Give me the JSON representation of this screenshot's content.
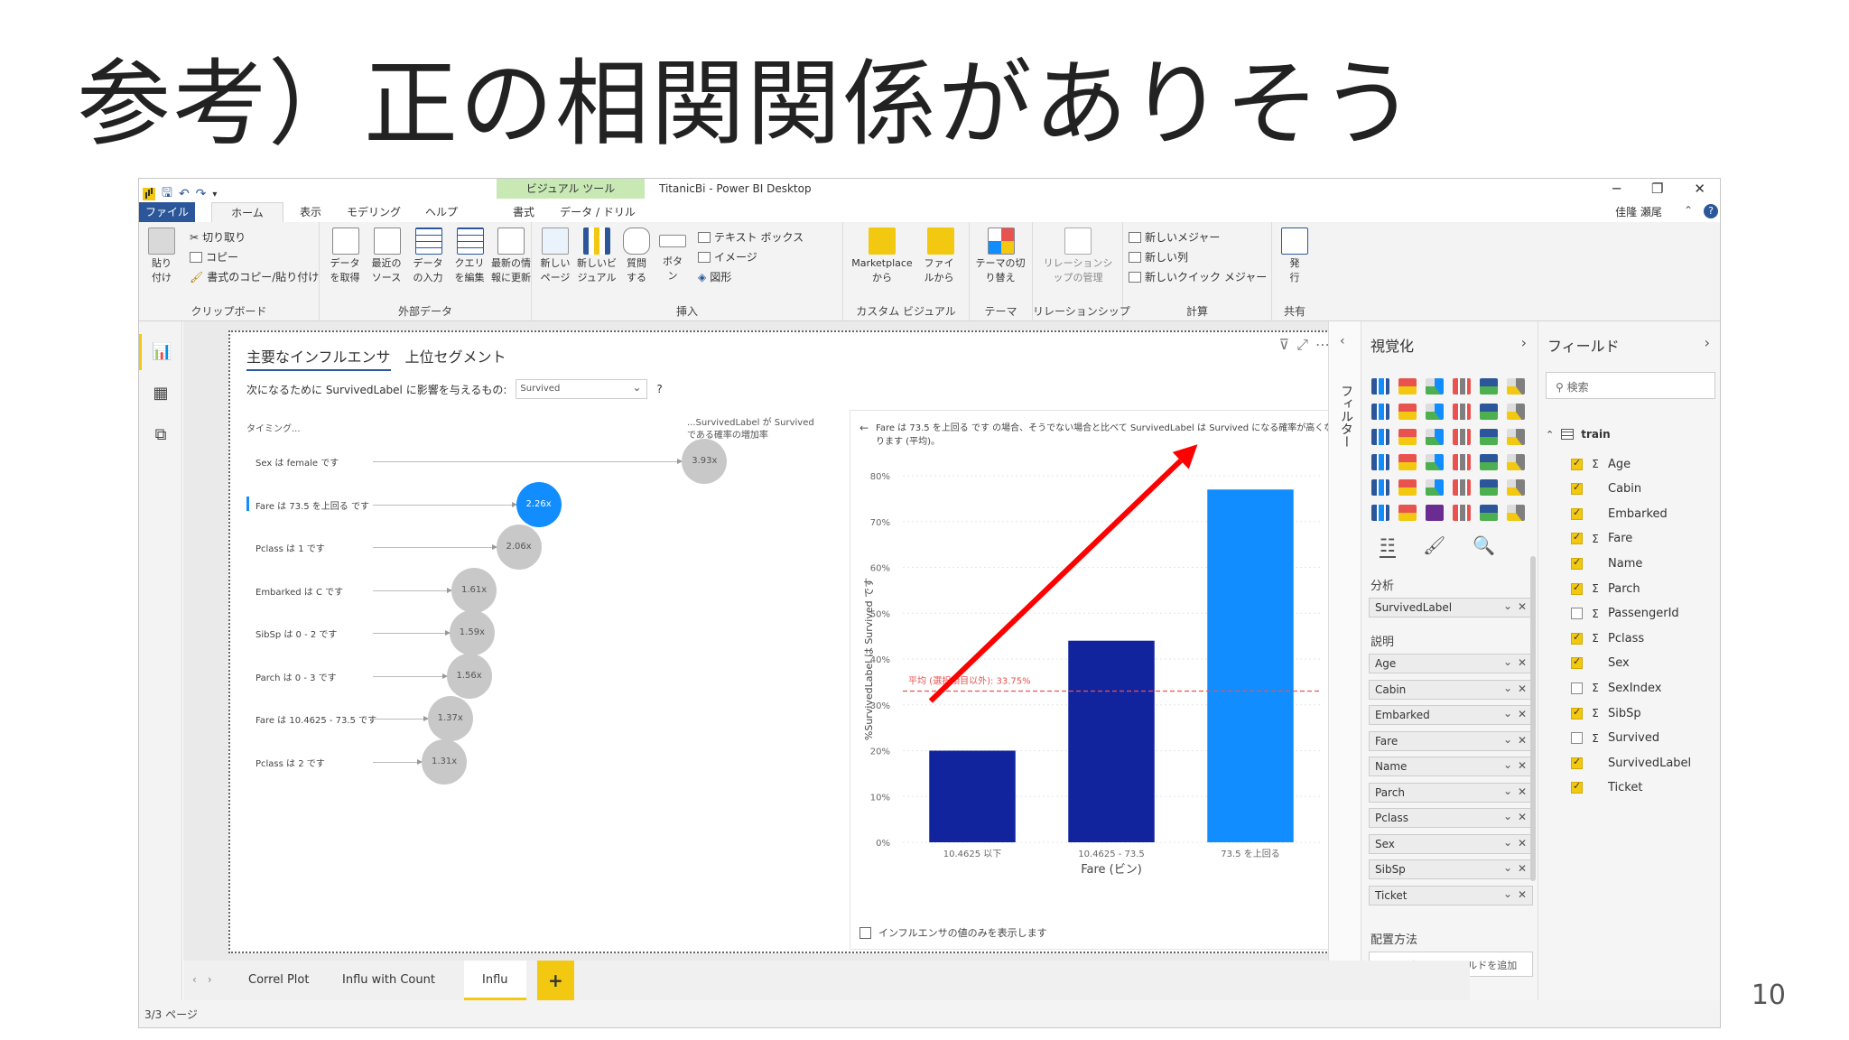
{
  "slide": {
    "title": "参考）正の相関関係がありそう",
    "number": "10"
  },
  "app": {
    "window_title": "TitanicBi - Power BI Desktop",
    "tool_tab": "ビジュアル ツール",
    "user": "佳隆 瀬尾",
    "tabs": [
      "ファイル",
      "ホーム",
      "表示",
      "モデリング",
      "ヘルプ",
      "書式",
      "データ / ドリル"
    ],
    "ribbon": {
      "clipboard": {
        "label": "クリップボード",
        "paste": "貼り付け",
        "cut": "切り取り",
        "copy": "コピー",
        "format_painter": "書式のコピー/貼り付け"
      },
      "external": {
        "label": "外部データ",
        "get_data": "データを取得",
        "recent": "最近のソース",
        "enter": "データの入力",
        "edit_query": "クエリを編集",
        "refresh": "最新の情報に更新"
      },
      "insert": {
        "label": "挿入",
        "new_page": "新しいページ",
        "new_visual": "新しいビジュアル",
        "ask": "質問する",
        "buttons": "ボタン",
        "textbox": "テキスト ボックス",
        "image": "イメージ",
        "shapes": "図形"
      },
      "custom": {
        "label": "カスタム ビジュアル",
        "marketplace": "Marketplace から",
        "file": "ファイルから"
      },
      "themes": {
        "label": "テーマ",
        "switch": "テーマの切り替え"
      },
      "relations": {
        "label": "リレーションシップ",
        "manage": "リレーションシップの管理"
      },
      "calc": {
        "label": "計算",
        "new_measure": "新しいメジャー",
        "new_column": "新しい列",
        "quick_measure": "新しいクイック メジャー"
      },
      "share": {
        "label": "共有",
        "publish": "発行"
      }
    }
  },
  "key_influencers": {
    "tab_main": "主要なインフルエンサ",
    "tab_segments": "上位セグメント",
    "question": "次になるために SurvivedLabel に影響を与えるもの:",
    "dropdown_value": "Survived",
    "help": "?",
    "col_left": "タイミング...",
    "col_right": "...SurvivedLabel が Survived である確率の増加率",
    "factors": [
      {
        "label": "Sex は female です",
        "value": 3.93,
        "text": "3.93x",
        "selected": false
      },
      {
        "label": "Fare は 73.5 を上回る です",
        "value": 2.26,
        "text": "2.26x",
        "selected": true
      },
      {
        "label": "Pclass は 1 です",
        "value": 2.06,
        "text": "2.06x",
        "selected": false
      },
      {
        "label": "Embarked は C です",
        "value": 1.61,
        "text": "1.61x",
        "selected": false
      },
      {
        "label": "SibSp は 0 - 2 です",
        "value": 1.59,
        "text": "1.59x",
        "selected": false
      },
      {
        "label": "Parch は 0 - 3 です",
        "value": 1.56,
        "text": "1.56x",
        "selected": false
      },
      {
        "label": "Fare は 10.4625 - 73.5 です",
        "value": 1.37,
        "text": "1.37x",
        "selected": false
      },
      {
        "label": "Pclass は 2 です",
        "value": 1.31,
        "text": "1.31x",
        "selected": false
      }
    ],
    "detail_description": "Fare は 73.5 を上回る です の場合、そうでない場合と比べて SurvivedLabel は Survived になる確率が高くなります (平均)。",
    "checkbox_label": "インフルエンサの値のみを表示します"
  },
  "chart_data": {
    "type": "bar",
    "categories": [
      "10.4625 以下",
      "10.4625 - 73.5",
      "73.5 を上回る"
    ],
    "values": [
      20,
      44,
      77
    ],
    "colors": [
      "#12239e",
      "#12239e",
      "#118dff"
    ],
    "xlabel": "Fare (ビン)",
    "ylabel": "%SurvivedLabel は Survived です",
    "ylim": [
      0,
      80
    ],
    "yticks": [
      0,
      10,
      20,
      30,
      40,
      50,
      60,
      70,
      80
    ],
    "ytick_labels": [
      "0%",
      "10%",
      "20%",
      "30%",
      "40%",
      "50%",
      "60%",
      "70%",
      "80%"
    ],
    "average_line": {
      "value": 33,
      "label": "平均 (選択項目以外): 33.75%",
      "color": "#e9534f"
    },
    "annotation": {
      "type": "arrow",
      "color": "#ff0000",
      "from_category": 0,
      "to_category": 2
    }
  },
  "pages": {
    "tabs": [
      "Correl Plot",
      "Influ with Count",
      "Influ"
    ],
    "active": "Influ",
    "add": "+",
    "status": "3/3 ページ"
  },
  "filters": {
    "label": "フィルター"
  },
  "visualizations": {
    "title": "視覚化",
    "analyze_label": "分析",
    "analyze_field": "SurvivedLabel",
    "explain_label": "説明",
    "explain_fields": [
      "Age",
      "Cabin",
      "Embarked",
      "Fare",
      "Name",
      "Parch",
      "Pclass",
      "Sex",
      "SibSp",
      "Ticket"
    ],
    "expand_label": "配置方法",
    "expand_placeholder": "ここにデータ フィールドを追加して..."
  },
  "fields": {
    "title": "フィールド",
    "search_placeholder": "検索",
    "table": "train",
    "items": [
      {
        "name": "Age",
        "sigma": true,
        "checked": true
      },
      {
        "name": "Cabin",
        "sigma": false,
        "checked": true
      },
      {
        "name": "Embarked",
        "sigma": false,
        "checked": true
      },
      {
        "name": "Fare",
        "sigma": true,
        "checked": true
      },
      {
        "name": "Name",
        "sigma": false,
        "checked": true
      },
      {
        "name": "Parch",
        "sigma": true,
        "checked": true
      },
      {
        "name": "PassengerId",
        "sigma": true,
        "checked": false
      },
      {
        "name": "Pclass",
        "sigma": true,
        "checked": true
      },
      {
        "name": "Sex",
        "sigma": false,
        "checked": true
      },
      {
        "name": "SexIndex",
        "sigma": true,
        "checked": false
      },
      {
        "name": "SibSp",
        "sigma": true,
        "checked": true
      },
      {
        "name": "Survived",
        "sigma": true,
        "checked": false
      },
      {
        "name": "SurvivedLabel",
        "sigma": false,
        "checked": true
      },
      {
        "name": "Ticket",
        "sigma": false,
        "checked": true
      }
    ]
  }
}
